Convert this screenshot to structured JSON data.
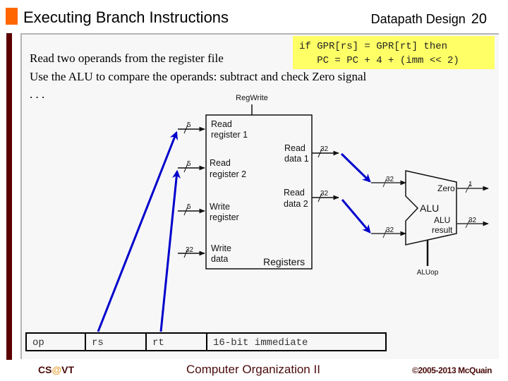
{
  "header": {
    "title": "Executing Branch Instructions",
    "section": "Datapath Design",
    "page_number": "20"
  },
  "code_box": {
    "line1": "if GPR[rs] = GPR[rt] then",
    "line2": "   PC = PC + 4 + (imm << 2)"
  },
  "body": {
    "lines": [
      "Read two operands from the register file",
      "Use the ALU to compare the operands: subtract and check Zero signal",
      ". . ."
    ]
  },
  "diagram": {
    "register_file": {
      "control_label": "RegWrite",
      "name": "Registers",
      "inputs": [
        {
          "label_line1": "Read",
          "label_line2": "register 1",
          "width": "5"
        },
        {
          "label_line1": "Read",
          "label_line2": "register 2",
          "width": "5"
        },
        {
          "label_line1": "Write",
          "label_line2": "register",
          "width": "5"
        },
        {
          "label_line1": "Write",
          "label_line2": "data",
          "width": "32"
        }
      ],
      "outputs": [
        {
          "label_line1": "Read",
          "label_line2": "data 1",
          "width": "32"
        },
        {
          "label_line1": "Read",
          "label_line2": "data 2",
          "width": "32"
        }
      ]
    },
    "alu": {
      "name": "ALU",
      "control_label": "ALUop",
      "input_widths": [
        "32",
        "32"
      ],
      "outputs": [
        {
          "label": "Zero",
          "width": "1"
        },
        {
          "label_line1": "ALU",
          "label_line2": "result",
          "width": "32"
        }
      ]
    },
    "highlight_color": "#0000cc"
  },
  "instruction_format": {
    "fields": [
      "op",
      "rs",
      "rt",
      "16-bit immediate"
    ]
  },
  "footer": {
    "left_prefix": "CS",
    "left_at": "@",
    "left_suffix": "VT",
    "center": "Computer Organization II",
    "right": "©2005-2013 McQuain"
  }
}
